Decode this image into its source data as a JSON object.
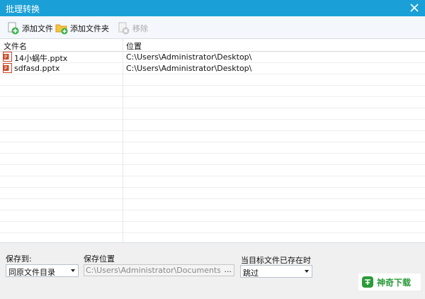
{
  "window": {
    "title": "批理转换"
  },
  "toolbar": {
    "add_file": "添加文件",
    "add_folder": "添加文件夹",
    "remove": "移除"
  },
  "file_list": {
    "columns": [
      "文件名",
      "位置"
    ],
    "rows": [
      {
        "name": "14小蜗牛.pptx",
        "location": "C:\\Users\\Administrator\\Desktop\\"
      },
      {
        "name": "sdfasd.pptx",
        "location": "C:\\Users\\Administrator\\Desktop\\"
      }
    ]
  },
  "bottom": {
    "save_to_label": "保存到:",
    "save_to_value": "同原文件目录",
    "save_location_label": "保存位置",
    "save_location_value": "C:\\Users\\Administrator\\Documents\\",
    "browse_label": "...",
    "exists_label": "当目标文件已存在时",
    "exists_value": "跳过"
  },
  "watermark": {
    "text": "神奇下载"
  },
  "colors": {
    "titlebar": "#1aa0d6",
    "accent_green": "#2b9b3a",
    "ppt_red": "#c84a2a"
  }
}
